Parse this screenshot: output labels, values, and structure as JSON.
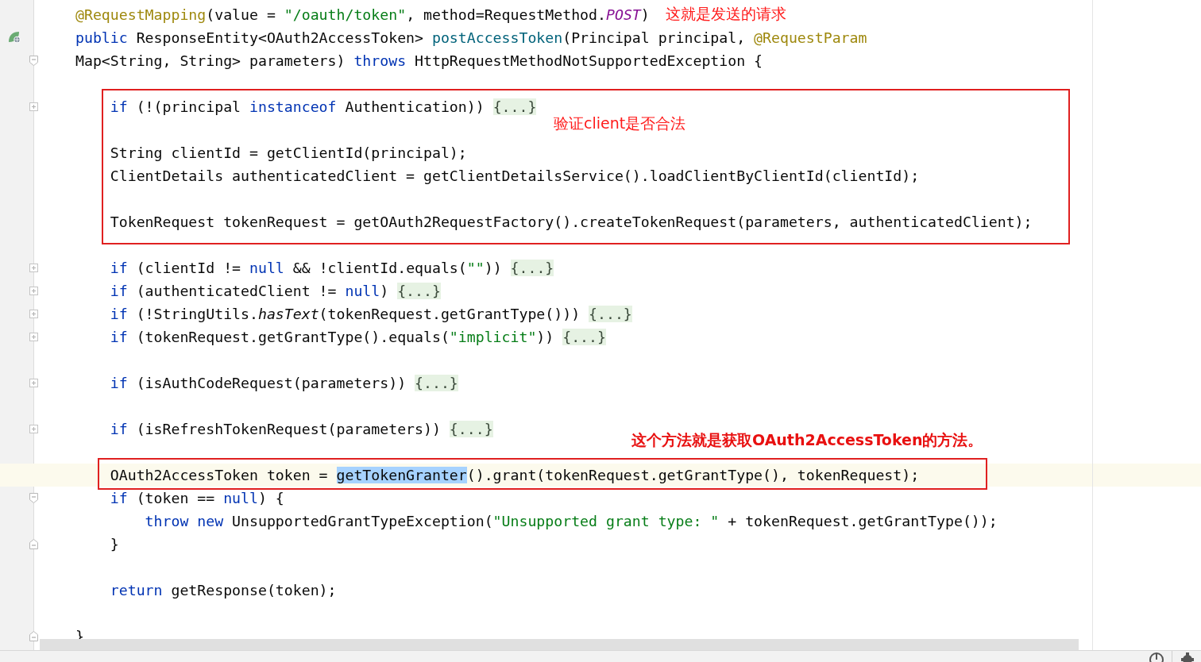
{
  "editor": {
    "lines": [
      {
        "current": false,
        "tokens": [
          {
            "text": "@RequestMapping",
            "kind": "annotation"
          },
          {
            "text": "(value = ",
            "kind": "plain"
          },
          {
            "text": "\"/oauth/token\"",
            "kind": "string"
          },
          {
            "text": ", method=RequestMethod.",
            "kind": "plain"
          },
          {
            "text": "POST",
            "kind": "constant"
          },
          {
            "text": ")",
            "kind": "plain"
          }
        ],
        "note": "这就是发送的请求"
      },
      {
        "current": false,
        "marker": {
          "kind": "bean"
        },
        "tokens": [
          {
            "text": "public",
            "kind": "keyword"
          },
          {
            "text": " ResponseEntity<OAuth2AccessToken> ",
            "kind": "plain"
          },
          {
            "text": "postAccessToken",
            "kind": "method"
          },
          {
            "text": "(Principal principal, ",
            "kind": "plain"
          },
          {
            "text": "@RequestParam",
            "kind": "annotation"
          }
        ]
      },
      {
        "current": false,
        "marker": {
          "kind": "fold-start"
        },
        "tokens": [
          {
            "text": "Map<String, String> parameters) ",
            "kind": "plain"
          },
          {
            "text": "throws",
            "kind": "keyword"
          },
          {
            "text": " HttpRequestMethodNotSupportedException {",
            "kind": "plain"
          }
        ]
      },
      {
        "current": false
      },
      {
        "current": false,
        "marker": {
          "kind": "fold-collapsed"
        },
        "tokens": [
          {
            "text": "    if",
            "kind": "keyword"
          },
          {
            "text": " (!(principal ",
            "kind": "plain"
          },
          {
            "text": "instanceof",
            "kind": "keyword"
          },
          {
            "text": " Authentication)) ",
            "kind": "plain"
          },
          {
            "text": "{...}",
            "kind": "folded"
          }
        ]
      },
      {
        "current": false
      },
      {
        "current": false,
        "tokens": [
          {
            "text": "    String clientId = getClientId(principal);",
            "kind": "plain"
          }
        ]
      },
      {
        "current": false,
        "tokens": [
          {
            "text": "    ClientDetails authenticatedClient = getClientDetailsService().loadClientByClientId(clientId);",
            "kind": "plain"
          }
        ]
      },
      {
        "current": false
      },
      {
        "current": false,
        "tokens": [
          {
            "text": "    TokenRequest tokenRequest = getOAuth2RequestFactory().createTokenRequest(parameters, authenticatedClient);",
            "kind": "plain"
          }
        ]
      },
      {
        "current": false
      },
      {
        "current": false,
        "marker": {
          "kind": "fold-collapsed"
        },
        "tokens": [
          {
            "text": "    if",
            "kind": "keyword"
          },
          {
            "text": " (clientId != ",
            "kind": "plain"
          },
          {
            "text": "null",
            "kind": "keyword"
          },
          {
            "text": " && !clientId.equals(",
            "kind": "plain"
          },
          {
            "text": "\"\"",
            "kind": "string"
          },
          {
            "text": ")) ",
            "kind": "plain"
          },
          {
            "text": "{...}",
            "kind": "folded"
          }
        ]
      },
      {
        "current": false,
        "marker": {
          "kind": "fold-collapsed"
        },
        "tokens": [
          {
            "text": "    if",
            "kind": "keyword"
          },
          {
            "text": " (authenticatedClient != ",
            "kind": "plain"
          },
          {
            "text": "null",
            "kind": "keyword"
          },
          {
            "text": ") ",
            "kind": "plain"
          },
          {
            "text": "{...}",
            "kind": "folded"
          }
        ]
      },
      {
        "current": false,
        "marker": {
          "kind": "fold-collapsed"
        },
        "tokens": [
          {
            "text": "    if",
            "kind": "keyword"
          },
          {
            "text": " (!StringUtils.",
            "kind": "plain"
          },
          {
            "text": "hasText",
            "kind": "static"
          },
          {
            "text": "(tokenRequest.getGrantType())) ",
            "kind": "plain"
          },
          {
            "text": "{...}",
            "kind": "folded"
          }
        ]
      },
      {
        "current": false,
        "marker": {
          "kind": "fold-collapsed"
        },
        "tokens": [
          {
            "text": "    if",
            "kind": "keyword"
          },
          {
            "text": " (tokenRequest.getGrantType().equals(",
            "kind": "plain"
          },
          {
            "text": "\"implicit\"",
            "kind": "string"
          },
          {
            "text": ")) ",
            "kind": "plain"
          },
          {
            "text": "{...}",
            "kind": "folded"
          }
        ]
      },
      {
        "current": false
      },
      {
        "current": false,
        "marker": {
          "kind": "fold-collapsed"
        },
        "tokens": [
          {
            "text": "    if",
            "kind": "keyword"
          },
          {
            "text": " (isAuthCodeRequest(parameters)) ",
            "kind": "plain"
          },
          {
            "text": "{...}",
            "kind": "folded"
          }
        ]
      },
      {
        "current": false
      },
      {
        "current": false,
        "marker": {
          "kind": "fold-collapsed"
        },
        "tokens": [
          {
            "text": "    if",
            "kind": "keyword"
          },
          {
            "text": " (isRefreshTokenRequest(parameters)) ",
            "kind": "plain"
          },
          {
            "text": "{...}",
            "kind": "folded"
          }
        ]
      },
      {
        "current": false
      },
      {
        "current": true,
        "tokens": [
          {
            "text": "    OAuth2AccessToken token = ",
            "kind": "plain"
          },
          {
            "text": "getTokenGranter",
            "kind": "selection"
          },
          {
            "text": "().grant(tokenRequest.getGrantType(), tokenRequest);",
            "kind": "plain"
          }
        ]
      },
      {
        "current": false,
        "marker": {
          "kind": "fold-start"
        },
        "tokens": [
          {
            "text": "    if",
            "kind": "keyword"
          },
          {
            "text": " (token == ",
            "kind": "plain"
          },
          {
            "text": "null",
            "kind": "keyword"
          },
          {
            "text": ") {",
            "kind": "plain"
          }
        ]
      },
      {
        "current": false,
        "tokens": [
          {
            "text": "        throw new",
            "kind": "keyword"
          },
          {
            "text": " UnsupportedGrantTypeException(",
            "kind": "plain"
          },
          {
            "text": "\"Unsupported grant type: \"",
            "kind": "string"
          },
          {
            "text": " + tokenRequest.getGrantType());",
            "kind": "plain"
          }
        ]
      },
      {
        "current": false,
        "marker": {
          "kind": "fold-end"
        },
        "tokens": [
          {
            "text": "    }",
            "kind": "plain"
          }
        ]
      },
      {
        "current": false
      },
      {
        "current": false,
        "tokens": [
          {
            "text": "    return",
            "kind": "keyword"
          },
          {
            "text": " getResponse(token);",
            "kind": "plain"
          }
        ]
      },
      {
        "current": false
      },
      {
        "current": false,
        "marker": {
          "kind": "fold-end"
        },
        "tokens": [
          {
            "text": "}",
            "kind": "plain"
          }
        ]
      }
    ]
  },
  "callouts": [
    {
      "text": "验证client是否合法",
      "kind": "plain"
    },
    {
      "text": "这个方法就是获取OAuth2AccessToken的方法。",
      "kind": "bold"
    }
  ]
}
